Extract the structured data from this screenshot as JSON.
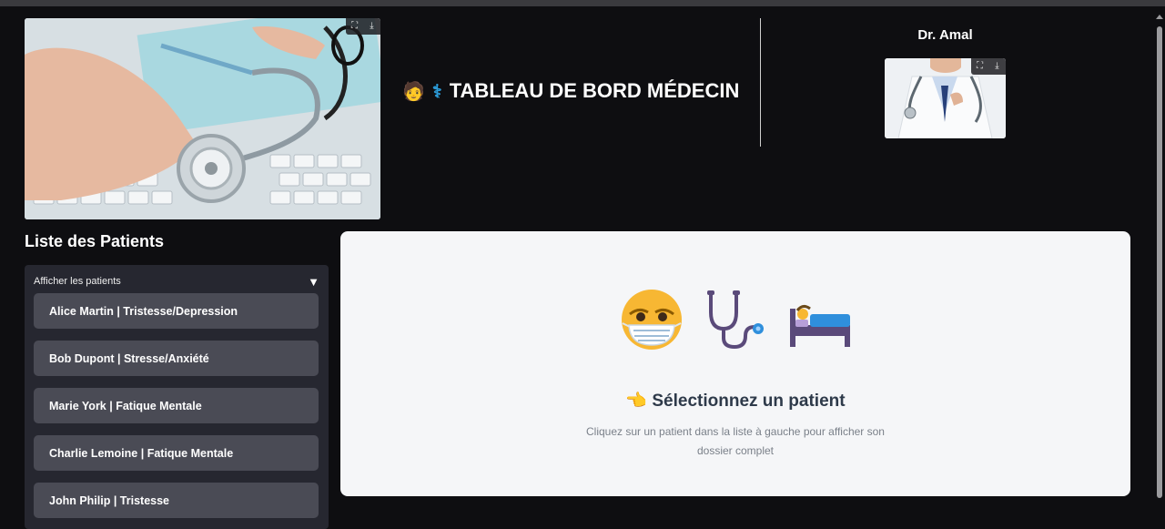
{
  "header": {
    "title": "TABLEAU DE BORD MÉDECIN",
    "emoji_1": "🧑",
    "emoji_2": "⚕",
    "doctor_name": "Dr. Amal"
  },
  "image_toolbar": {
    "fullscreen_icon": "fullscreen-icon",
    "download_icon": "download-icon"
  },
  "sidebar": {
    "title": "Liste des Patients",
    "expander_label": "Afficher les patients",
    "patients": [
      {
        "label": "Alice Martin | Tristesse/Depression"
      },
      {
        "label": "Bob Dupont | Stresse/Anxiété"
      },
      {
        "label": "Marie York | Fatique Mentale"
      },
      {
        "label": "Charlie Lemoine | Fatique Mentale"
      },
      {
        "label": "John Philip | Tristesse"
      }
    ]
  },
  "main": {
    "icons": [
      "face-with-mask-icon",
      "stethoscope-icon",
      "person-in-bed-icon"
    ],
    "select_title": "Sélectionnez un patient",
    "select_emoji": "👈",
    "select_subtitle": "Cliquez sur un patient dans la liste à gauche pour afficher son dossier complet"
  },
  "colors": {
    "background": "#0e0e11",
    "panel": "#262730",
    "button": "#4a4b55",
    "card": "#f5f6f8",
    "heading_dark": "#2e3a4a"
  }
}
